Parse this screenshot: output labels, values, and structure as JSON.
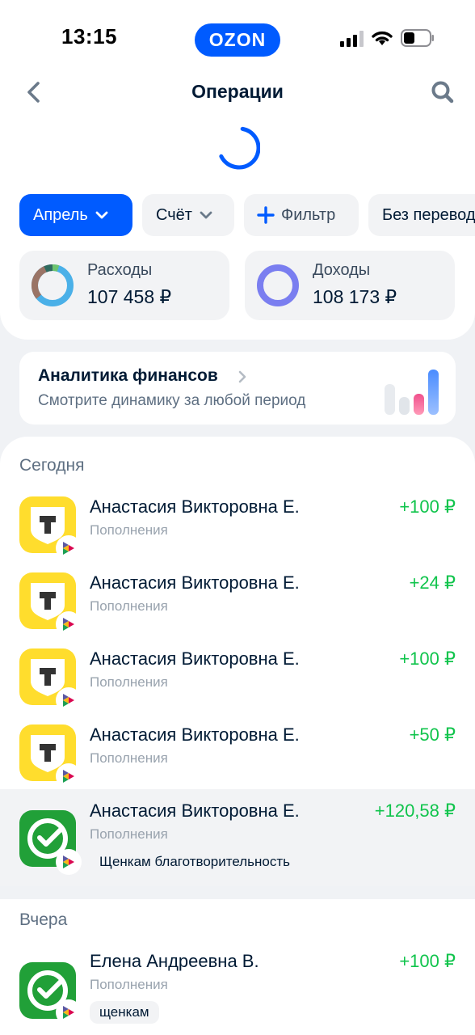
{
  "status_bar": {
    "time": "13:15",
    "brand": "OZON",
    "icons": [
      "cellular-signal-icon",
      "wifi-icon",
      "battery-icon"
    ]
  },
  "header": {
    "title": "Операции",
    "back_icon": "chevron-left-icon",
    "search_icon": "search-icon"
  },
  "filters": {
    "month": "Апрель",
    "account": "Счёт",
    "filter": "Фильтр",
    "transfers": "Без переводов"
  },
  "summary": {
    "expenses_label": "Расходы",
    "expenses_value": "107 458 ₽",
    "income_label": "Доходы",
    "income_value": "108 173 ₽"
  },
  "analytics": {
    "title": "Аналитика финансов",
    "subtitle": "Смотрите динамику за любой период"
  },
  "sections": {
    "today": "Сегодня",
    "yesterday": "Вчера"
  },
  "operations": [
    {
      "name": "Анастасия Викторовна Е.",
      "category": "Пополнения",
      "amount": "+100 ₽",
      "bank": "tbank"
    },
    {
      "name": "Анастасия Викторовна Е.",
      "category": "Пополнения",
      "amount": "+24 ₽",
      "bank": "tbank"
    },
    {
      "name": "Анастасия Викторовна Е.",
      "category": "Пополнения",
      "amount": "+100 ₽",
      "bank": "tbank"
    },
    {
      "name": "Анастасия Викторовна Е.",
      "category": "Пополнения",
      "amount": "+50 ₽",
      "bank": "tbank"
    },
    {
      "name": "Анастасия Викторовна Е.",
      "category": "Пополнения",
      "amount": "+120,58 ₽",
      "bank": "sber",
      "note": "Щенкам благотворительность"
    },
    {
      "name": "Елена Андреевна В.",
      "category": "Пополнения",
      "amount": "+100 ₽",
      "bank": "sber",
      "note": "щенкам"
    }
  ],
  "colors": {
    "accent": "#005bff",
    "income_green": "#10c44c",
    "tbank_yellow": "#ffdd2d",
    "sber_green": "#21a038",
    "text_primary": "#001a34",
    "text_secondary": "#5e6f82"
  }
}
